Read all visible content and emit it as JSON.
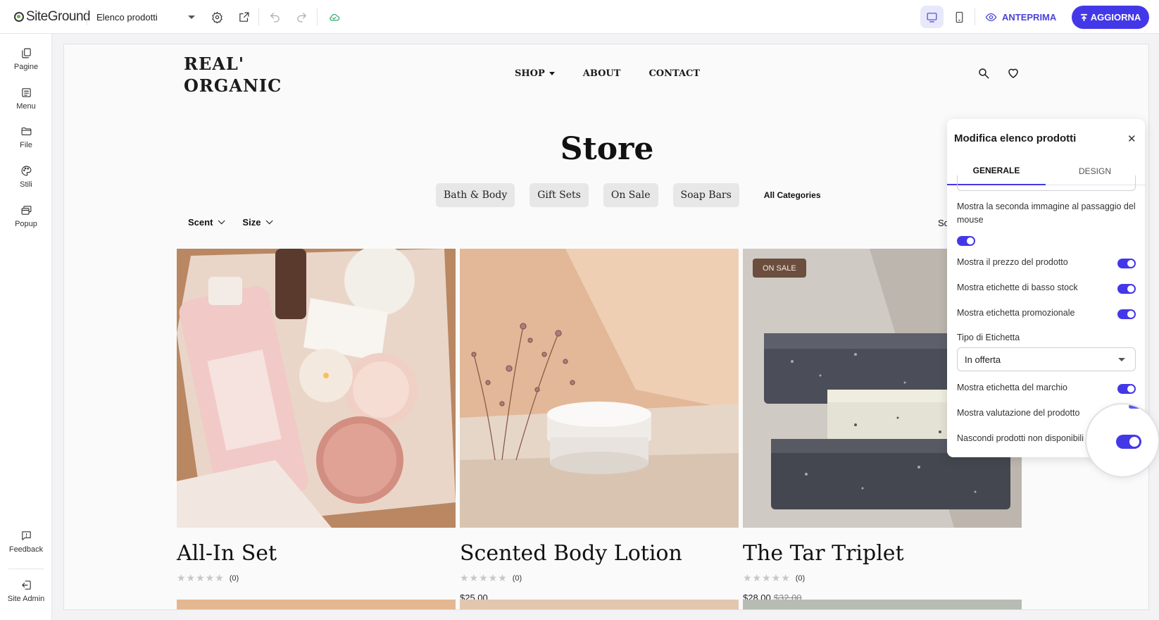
{
  "topbar": {
    "logo_text": "SiteGround",
    "page_selector": "Elenco prodotti",
    "preview_label": "ANTEPRIMA",
    "update_label": "AGGIORNA",
    "icons": [
      "settings-icon",
      "external-link-icon",
      "undo-icon",
      "redo-icon",
      "cloud-icon",
      "desktop-icon",
      "mobile-icon",
      "eye-icon"
    ]
  },
  "sidebar": {
    "items": [
      {
        "label": "Pagine",
        "icon": "pages-icon"
      },
      {
        "label": "Menu",
        "icon": "menu-icon"
      },
      {
        "label": "File",
        "icon": "folder-icon"
      },
      {
        "label": "Stili",
        "icon": "palette-icon"
      },
      {
        "label": "Popup",
        "icon": "popup-icon"
      }
    ],
    "bottom": [
      {
        "label": "Feedback",
        "icon": "feedback-icon"
      },
      {
        "label": "Site Admin",
        "icon": "exit-icon"
      }
    ]
  },
  "site": {
    "logo_line1": "REAL'",
    "logo_line2": "ORGANIC",
    "nav": [
      "SHOP",
      "ABOUT",
      "CONTACT"
    ],
    "title": "Store",
    "categories": [
      "Bath & Body",
      "Gift Sets",
      "On Sale",
      "Soap Bars"
    ],
    "all_categories": "All Categories",
    "filters": [
      "Scent",
      "Size"
    ],
    "sort_peek": "Sc",
    "products": [
      {
        "name": "All-In Set",
        "stars": "★★★★★",
        "reviews": "(0)",
        "price": "",
        "old_price": "",
        "badge": ""
      },
      {
        "name": "Scented Body Lotion",
        "stars": "★★★★★",
        "reviews": "(0)",
        "price": "$25.00",
        "old_price": "",
        "badge": ""
      },
      {
        "name": "The Tar Triplet",
        "stars": "★★★★★",
        "reviews": "(0)",
        "price": "$28.00",
        "old_price": "$32.00",
        "badge": "ON SALE"
      }
    ]
  },
  "panel": {
    "title": "Modifica elenco prodotti",
    "close": "✕",
    "tabs": [
      "GENERALE",
      "DESIGN"
    ],
    "active_tab": "GENERALE",
    "options": {
      "hover_image": {
        "label": "Mostra la seconda immagine al passaggio del mouse",
        "on": true
      },
      "show_price": {
        "label": "Mostra il prezzo del prodotto",
        "on": true
      },
      "low_stock": {
        "label": "Mostra etichette di basso stock",
        "on": true
      },
      "promo_label": {
        "label": "Mostra etichetta promozionale",
        "on": true
      },
      "brand_label": {
        "label": "Mostra etichetta del marchio",
        "on": true
      },
      "rating": {
        "label": "Mostra valutazione del prodotto",
        "on": true
      },
      "hide_unavailable": {
        "label": "Nascondi prodotti non disponibili",
        "on": true
      }
    },
    "label_type": {
      "label": "Tipo di Etichetta",
      "value": "In offerta"
    }
  },
  "colors": {
    "accent": "#4338e8",
    "sale_badge": "#6b4e3d",
    "cloud": "#2ea86b"
  }
}
